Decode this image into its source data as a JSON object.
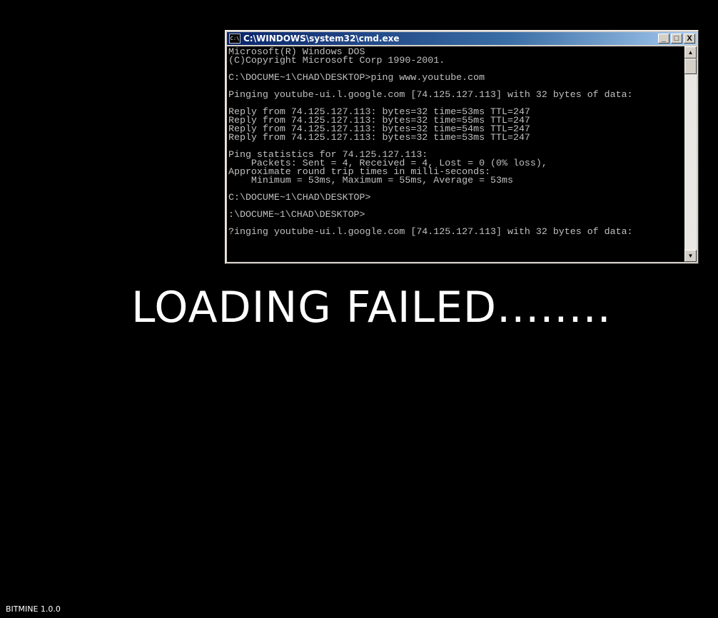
{
  "window": {
    "title": "C:\\WINDOWS\\system32\\cmd.exe",
    "icon_label": "C:\\",
    "buttons": {
      "minimize": "_",
      "maximize": "□",
      "close": "X"
    },
    "lines": [
      "Microsoft(R) Windows DOS",
      "(C)Copyright Microsoft Corp 1990-2001.",
      "",
      "C:\\DOCUME~1\\CHAD\\DESKTOP>ping www.youtube.com",
      "",
      "Pinging youtube-ui.l.google.com [74.125.127.113] with 32 bytes of data:",
      "",
      "Reply from 74.125.127.113: bytes=32 time=53ms TTL=247",
      "Reply from 74.125.127.113: bytes=32 time=55ms TTL=247",
      "Reply from 74.125.127.113: bytes=32 time=54ms TTL=247",
      "Reply from 74.125.127.113: bytes=32 time=53ms TTL=247",
      "",
      "Ping statistics for 74.125.127.113:",
      "    Packets: Sent = 4, Received = 4, Lost = 0 (0% loss),",
      "Approximate round trip times in milli-seconds:",
      "    Minimum = 53ms, Maximum = 55ms, Average = 53ms",
      "",
      "C:\\DOCUME~1\\CHAD\\DESKTOP>",
      "",
      ":\\DOCUME~1\\CHAD\\DESKTOP>",
      "",
      "?inging youtube-ui.l.google.com [74.125.127.113] with 32 bytes of data:"
    ]
  },
  "message": "LOADING FAILED........",
  "version": "BITMINE 1.0.0"
}
